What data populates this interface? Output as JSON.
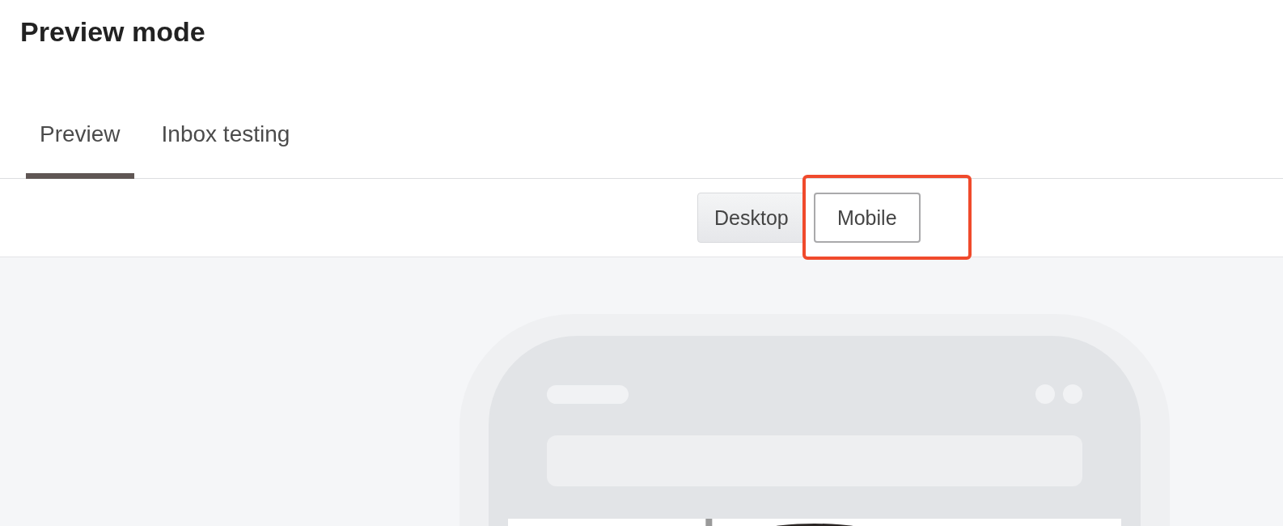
{
  "header": {
    "title": "Preview mode"
  },
  "tabs": [
    {
      "label": "Preview",
      "selected": true
    },
    {
      "label": "Inbox testing",
      "selected": false
    }
  ],
  "view_toggle": [
    {
      "label": "Desktop",
      "selected": false,
      "highlighted": false
    },
    {
      "label": "Mobile",
      "selected": true,
      "highlighted": true
    }
  ]
}
